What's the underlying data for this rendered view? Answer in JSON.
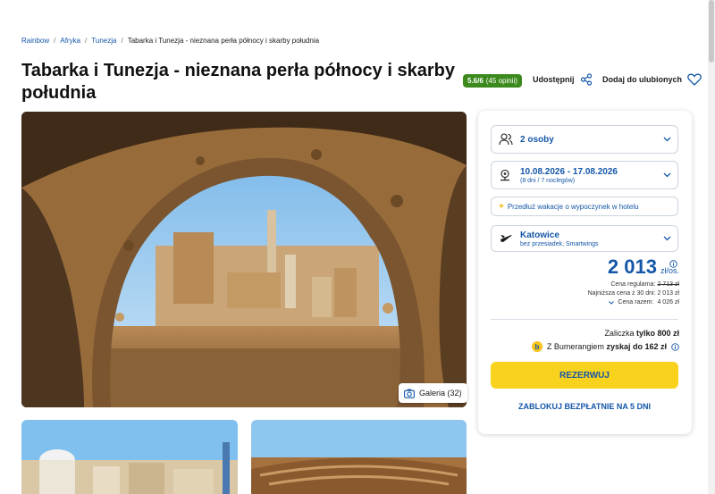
{
  "breadcrumb": {
    "items": [
      "Rainbow",
      "Afryka",
      "Tunezja"
    ],
    "current": "Tabarka i Tunezja - nieznana perła północy i skarby południa"
  },
  "header": {
    "title": "Tabarka i Tunezja - nieznana perła północy i skarby południa",
    "rating_value": "5.6/6",
    "rating_count": "(45 opinii)",
    "share_label": "Udostępnij",
    "favorite_label": "Dodaj do ulubionych"
  },
  "gallery": {
    "label": "Galeria (32)"
  },
  "booking": {
    "persons": "2 osoby",
    "dates": "10.08.2026 - 17.08.2026",
    "dates_sub": "(8 dni / 7 noclegów)",
    "extend_label": "Przedłuż wakacje o wypoczynek w hotelu",
    "departure_city": "Katowice",
    "departure_sub": "bez przesiadek, Smartwings",
    "price": "2 013",
    "price_unit": "zł/os.",
    "regular_label": "Cena regularna:",
    "regular_price": "2 713 zł",
    "lowest_label": "Najniższa cena z 30 dni:",
    "lowest_price": "2 013 zł",
    "total_label": "Cena razem:",
    "total_price": "4 026 zł",
    "deposit_prefix": "Zaliczka",
    "deposit_value": "tylko 800 zł",
    "boomerang_prefix": "Z Bumerangiem",
    "boomerang_value": "zyskaj do 162 zł",
    "boomerang_logo": "b",
    "reserve_label": "REZERWUJ",
    "block_label": "ZABLOKUJ BEZPŁATNIE NA 5 DNI"
  },
  "colors": {
    "brand_blue": "#1457a8",
    "accent_yellow": "#f8d21c",
    "rating_green": "#3c8a1e"
  },
  "icons": [
    "share-icon",
    "heart-icon",
    "camera-icon",
    "people-icon",
    "calendar-icon",
    "plane-icon",
    "chevron-down-icon",
    "info-icon",
    "plus-icon"
  ]
}
